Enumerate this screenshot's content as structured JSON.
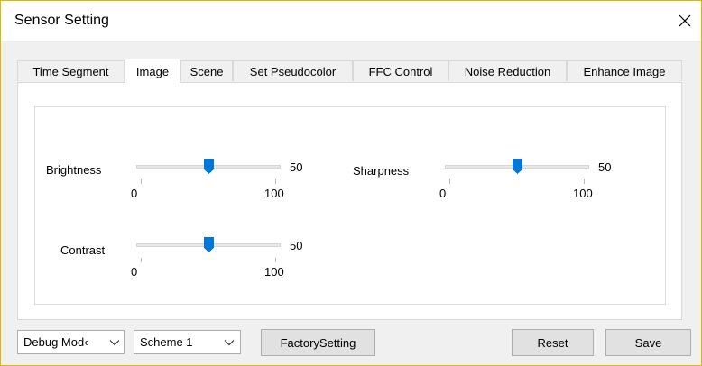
{
  "window": {
    "title": "Sensor Setting"
  },
  "tabs": [
    {
      "label": "Time Segment",
      "active": false
    },
    {
      "label": "Image",
      "active": true
    },
    {
      "label": "Scene",
      "active": false
    },
    {
      "label": "Set Pseudocolor",
      "active": false
    },
    {
      "label": "FFC Control",
      "active": false
    },
    {
      "label": "Noise Reduction",
      "active": false
    },
    {
      "label": "Enhance Image",
      "active": false
    }
  ],
  "controls": {
    "brightness": {
      "label": "Brightness",
      "value": 50,
      "min": 0,
      "max": 100,
      "min_label": "0",
      "max_label": "100"
    },
    "sharpness": {
      "label": "Sharpness",
      "value": 50,
      "min": 0,
      "max": 100,
      "min_label": "0",
      "max_label": "100"
    },
    "contrast": {
      "label": "Contrast",
      "value": 50,
      "min": 0,
      "max": 100,
      "min_label": "0",
      "max_label": "100"
    }
  },
  "footer": {
    "mode_select": {
      "value": "Debug Mod‹"
    },
    "scheme_select": {
      "value": "Scheme 1"
    },
    "factory_label": "FactorySetting",
    "reset_label": "Reset",
    "save_label": "Save"
  },
  "colors": {
    "accent": "#0078d7",
    "window_border": "#e0b800",
    "client_bg": "#f0f0f0"
  },
  "icons": {
    "close": "close-icon",
    "dropdown": "chevron-down-icon"
  }
}
